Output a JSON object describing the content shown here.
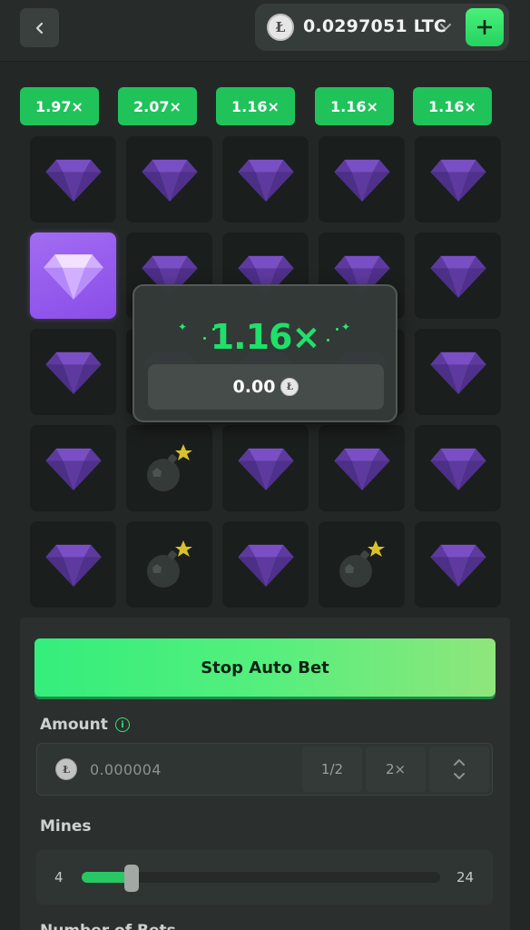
{
  "header": {
    "back_icon": "chevron-left-icon",
    "balance": "0.0297051 LTC",
    "currency_symbol": "Ł",
    "currency_icon": "litecoin-icon",
    "dropdown_icon": "chevron-down-icon",
    "deposit_label": "+"
  },
  "multipliers": [
    "1.97×",
    "2.07×",
    "1.16×",
    "1.16×",
    "1.16×"
  ],
  "board": {
    "rows": 5,
    "cols": 5,
    "tiles": [
      "gem",
      "gem",
      "gem",
      "gem",
      "gem",
      "gem-revealed",
      "gem",
      "gem",
      "gem",
      "gem",
      "gem",
      "gem",
      "gem",
      "gem",
      "gem",
      "gem",
      "mine",
      "gem",
      "gem",
      "gem",
      "gem",
      "mine",
      "gem",
      "mine",
      "gem"
    ]
  },
  "result": {
    "multiplier": "1.16×",
    "payout": "0.00",
    "coin_symbol": "Ł"
  },
  "controls": {
    "stop_label": "Stop Auto Bet",
    "amount_label": "Amount",
    "amount_info_icon": "info-icon",
    "amount_info_glyph": "i",
    "amount_value": "0.000004",
    "half_label": "1/2",
    "double_label": "2×",
    "mines_label": "Mines",
    "mines_min": "4",
    "mines_max": "24",
    "mines_value_fraction": 0.12,
    "next_label": "Number of Bets"
  },
  "colors": {
    "accent_green": "#1fc35a",
    "gem_purple": "#6a42b0",
    "revealed_purple": "#9a60f0",
    "background": "#232826"
  }
}
